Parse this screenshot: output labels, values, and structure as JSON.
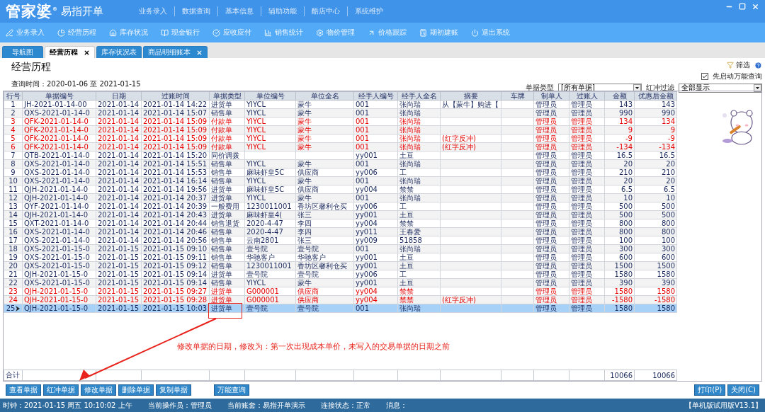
{
  "window": {
    "brand": "管家婆$^{®}$",
    "product": "易指开单"
  },
  "menu": [
    "业务录入",
    "数据查询",
    "基本信息",
    "辅助功能",
    "酷店中心",
    "系统维护"
  ],
  "toolbar": [
    "业务录入",
    "经营历程",
    "库存状况",
    "现金银行",
    "应收应付",
    "销售统计",
    "物价管理",
    "价格跟踪",
    "期初建账",
    "退出系统"
  ],
  "tabs": [
    {
      "label": "导航图",
      "selected": false,
      "closable": false
    },
    {
      "label": "经营历程",
      "selected": true,
      "closable": true
    },
    {
      "label": "库存状况表",
      "selected": false,
      "closable": false
    },
    {
      "label": "商品明细账本",
      "selected": false,
      "closable": true
    }
  ],
  "page": {
    "title": "经营历程",
    "query": "查询时间：2020-01-06 至 2021-01-15",
    "filter_link": "筛选",
    "auto_query": {
      "label": "先启动万能查询",
      "checked": true
    },
    "filters": [
      {
        "label": "单据类型",
        "value": "[所有单据]"
      },
      {
        "label": "红冲过滤",
        "value": "全部显示"
      }
    ]
  },
  "table": {
    "columns": [
      "行号",
      "单据编号",
      "日期",
      "过账时间",
      "单据类型",
      "单位编号",
      "单位全名",
      "经手人编号",
      "经手人全名",
      "摘要",
      "车牌",
      "制单人",
      "过账人",
      "金额",
      "优惠后金额"
    ],
    "rows": [
      {
        "red": false,
        "selected": false,
        "cells": [
          "1",
          "JH-2021-01-14-00",
          "2021-01-14",
          "2021-01-14 14:22",
          "进货单",
          "YIYCL",
          "蒙牛",
          "001",
          "张尚瑞",
          "从【蒙牛】购进【",
          null,
          "管理员",
          "管理员",
          "143",
          "143"
        ]
      },
      {
        "red": false,
        "selected": false,
        "cells": [
          "2",
          "QXS-2021-01-14-0",
          "2021-01-14",
          "2021-01-14 15:07",
          "销售单",
          "YIYCL",
          "蒙牛",
          "001",
          "张尚瑞",
          null,
          null,
          "管理员",
          "管理员",
          "990",
          "990"
        ]
      },
      {
        "red": true,
        "selected": false,
        "cells": [
          "3",
          "QFK-2021-01-14-0",
          "2021-01-14",
          "2021-01-14 15:09",
          "付款单",
          "YIYCL",
          "蒙牛",
          "001",
          "张尚瑞",
          null,
          null,
          "管理员",
          "管理员",
          "134",
          "134"
        ]
      },
      {
        "red": true,
        "selected": false,
        "cells": [
          "4",
          "QFK-2021-01-14-0",
          "2021-01-14",
          "2021-01-14 15:09",
          "付款单",
          "YIYCL",
          "蒙牛",
          "001",
          "张尚瑞",
          null,
          null,
          "管理员",
          "管理员",
          "9",
          "9"
        ]
      },
      {
        "red": true,
        "selected": false,
        "cells": [
          "5",
          "QFK-2021-01-14-0",
          "2021-01-14",
          "2021-01-14 15:09",
          "付款单",
          "YIYCL",
          "蒙牛",
          "001",
          "张尚瑞",
          "(红字反冲)",
          null,
          "管理员",
          "管理员",
          "-9",
          "-9"
        ]
      },
      {
        "red": true,
        "selected": false,
        "cells": [
          "6",
          "QFK-2021-01-14-0",
          "2021-01-14",
          "2021-01-14 15:09",
          "付款单",
          "YIYCL",
          "蒙牛",
          "001",
          "张尚瑞",
          "(红字反冲)",
          null,
          "管理员",
          "管理员",
          "-134",
          "-134"
        ]
      },
      {
        "red": false,
        "selected": false,
        "cells": [
          "7",
          "QTB-2021-01-14-0",
          "2021-01-14",
          "2021-01-14 15:20",
          "同价调拨",
          null,
          null,
          "yy001",
          "土豆",
          null,
          null,
          "管理员",
          "管理员",
          "16.5",
          "16.5"
        ]
      },
      {
        "red": false,
        "selected": false,
        "cells": [
          "8",
          "QXS-2021-01-14-0",
          "2021-01-14",
          "2021-01-14 15:51",
          "销售单",
          "YIYCL",
          "蒙牛",
          "001",
          "张尚瑞",
          null,
          null,
          "管理员",
          "管理员",
          "20",
          "20"
        ]
      },
      {
        "red": false,
        "selected": false,
        "cells": [
          "9",
          "QXS-2021-01-14-0",
          "2021-01-14",
          "2021-01-14 15:53",
          "销售单",
          "麻味虾皇5C",
          "供应商",
          "yy006",
          "工",
          null,
          null,
          "管理员",
          "管理员",
          "210",
          "210"
        ]
      },
      {
        "red": false,
        "selected": false,
        "cells": [
          "10",
          "QXS-2021-01-14-0",
          "2021-01-14",
          "2021-01-14 16:14",
          "销售单",
          "YIYCL",
          "蒙牛",
          "001",
          "张尚瑞",
          null,
          null,
          "管理员",
          "管理员",
          "20",
          "20"
        ]
      },
      {
        "red": false,
        "selected": false,
        "cells": [
          "11",
          "QJH-2021-01-14-0",
          "2021-01-14",
          "2021-01-14 19:56",
          "进货单",
          "麻味虾皇5C",
          "供应商",
          "yy004",
          "禁禁",
          null,
          null,
          "管理员",
          "管理员",
          "6.5",
          "6.5"
        ]
      },
      {
        "red": false,
        "selected": false,
        "cells": [
          "12",
          "QJH-2021-01-14-0",
          "2021-01-14",
          "2021-01-14 20:37",
          "进货单",
          "YIYCL",
          "蒙牛",
          "001",
          "张尚瑞",
          null,
          null,
          "管理员",
          "管理员",
          "10",
          "10"
        ]
      },
      {
        "red": false,
        "selected": false,
        "cells": [
          "13",
          "QYF-2021-01-14-0",
          "2021-01-14",
          "2021-01-14 20:39",
          "一般费用",
          "1230011001",
          "香坊区馨利仓买",
          "yy006",
          "工",
          null,
          null,
          "管理员",
          "管理员",
          "500",
          "500"
        ]
      },
      {
        "red": false,
        "selected": false,
        "cells": [
          "14",
          "QJH-2021-01-14-0",
          "2021-01-14",
          "2021-01-14 20:43",
          "进货单",
          "麻味虾皇4(",
          "张三",
          "yy001",
          "土豆",
          null,
          null,
          "管理员",
          "管理员",
          "500",
          "500"
        ]
      },
      {
        "red": false,
        "selected": false,
        "cells": [
          "15",
          "QXT-2021-01-14-0",
          "2021-01-14",
          "2021-01-14 20:44",
          "销售退货",
          "2020-4-47",
          "李四",
          "yy004",
          "禁禁",
          null,
          null,
          "管理员",
          "管理员",
          "800",
          "800"
        ]
      },
      {
        "red": false,
        "selected": false,
        "cells": [
          "16",
          "QXS-2021-01-14-0",
          "2021-01-14",
          "2021-01-14 20:46",
          "销售单",
          "2020-4-47",
          "李四",
          "yy011",
          "王春爱",
          null,
          null,
          "管理员",
          "管理员",
          "800",
          "800"
        ]
      },
      {
        "red": false,
        "selected": false,
        "cells": [
          "17",
          "QXS-2021-01-14-0",
          "2021-01-14",
          "2021-01-14 20:56",
          "销售单",
          "云南2801",
          "张三",
          "yy009",
          "51858",
          null,
          null,
          "管理员",
          "管理员",
          "100",
          "100"
        ]
      },
      {
        "red": false,
        "selected": false,
        "cells": [
          "18",
          "QXS-2021-01-15-0",
          "2021-01-15",
          "2021-01-15 09:10",
          "销售单",
          "壹号院",
          "壹号院",
          "001",
          "张尚瑞",
          null,
          null,
          "管理员",
          "管理员",
          "300",
          "300"
        ]
      },
      {
        "red": false,
        "selected": false,
        "cells": [
          "19",
          "QXS-2021-01-15-0",
          "2021-01-15",
          "2021-01-15 09:11",
          "销售单",
          "华驰客户",
          "华驰客户",
          "yy001",
          "土豆",
          null,
          null,
          "管理员",
          "管理员",
          "600",
          "600"
        ]
      },
      {
        "red": false,
        "selected": false,
        "cells": [
          "20",
          "QXS-2021-01-15-0",
          "2021-01-15",
          "2021-01-15 09:12",
          "销售单",
          "1230011001",
          "香坊区馨利仓买",
          "yy001",
          "土豆",
          null,
          null,
          "管理员",
          "管理员",
          "1500",
          "1500"
        ]
      },
      {
        "red": false,
        "selected": false,
        "cells": [
          "21",
          "QJH-2021-01-15-0",
          "2021-01-15",
          "2021-01-15 09:14",
          "进货单",
          "壹号院",
          "壹号院",
          "yy006",
          "工",
          null,
          null,
          "管理员",
          "管理员",
          "1580",
          "1580"
        ]
      },
      {
        "red": false,
        "selected": false,
        "cells": [
          "22",
          "QXS-2021-01-15-0",
          "2021-01-15",
          "2021-01-15 09:14",
          "销售单",
          "YIYCL",
          "蒙牛",
          "yy001",
          "土豆",
          null,
          null,
          "管理员",
          "管理员",
          "390",
          "390"
        ]
      },
      {
        "red": true,
        "selected": false,
        "cells": [
          "23",
          "QJH-2021-01-15-0",
          "2021-01-15",
          "2021-01-15 09:27",
          "进货单",
          "G000001",
          "供应商",
          "yy004",
          "禁禁",
          null,
          null,
          "管理员",
          "管理员",
          "1580",
          "1580"
        ]
      },
      {
        "red": true,
        "selected": false,
        "cells": [
          "24",
          "QJH-2021-01-15-0",
          "2021-01-15",
          "2021-01-15 09:28",
          "进货单",
          "G000001",
          "供应商",
          "yy004",
          "禁禁",
          "(红字反冲)",
          null,
          "管理员",
          "管理员",
          "-1580",
          "-1580"
        ]
      },
      {
        "red": false,
        "selected": true,
        "cells": [
          "25",
          "QJH-2021-01-15-0",
          "2021-01-15",
          "2021-01-15 10:03",
          "进货单",
          "壹号院",
          "壹号院",
          "001",
          "张尚瑞",
          null,
          null,
          "管理员",
          "管理员",
          "1580",
          "1580"
        ]
      }
    ],
    "totals": {
      "label": "合计",
      "amount": "10066",
      "discounted": "10066"
    }
  },
  "annotation": {
    "text": "修改单据的日期，修改为：第一次出现成本单价，未写入的交易单据的日期之前"
  },
  "actions": [
    "查看单据",
    "红冲单据",
    "修改单据",
    "删除单据",
    "复制单据"
  ],
  "query_button": "万能查询",
  "right_buttons": [
    "打印(P)",
    "关闭(C)"
  ],
  "status_bar": [
    "时钟：2021-01-15 周五 10:10:02 上午",
    "当前操作员：管理员",
    "当前账套：易指开单演示",
    "连接状态：正常",
    "消息："
  ],
  "version": "【单机版试用版V13.1】"
}
